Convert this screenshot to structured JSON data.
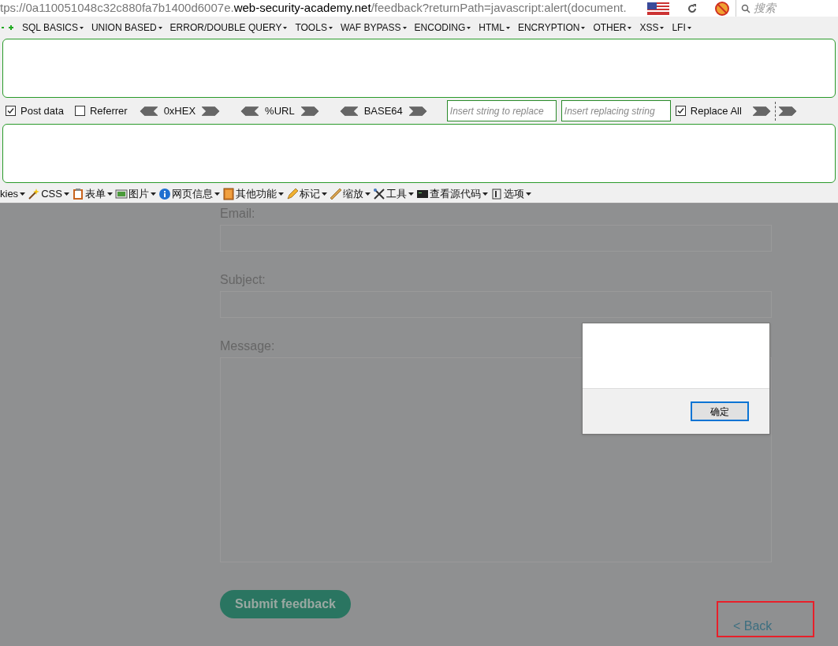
{
  "address_bar": {
    "url_prefix": "tps://0a110051048c32c880fa7b1400d6007e.",
    "url_host": "web-security-academy.net",
    "url_path": "/feedback?returnPath=javascript:alert(document."
  },
  "search": {
    "placeholder": "搜索"
  },
  "hackbar": {
    "menus": [
      "SQL BASICS",
      "UNION BASED",
      "ERROR/DOUBLE QUERY",
      "TOOLS",
      "WAF BYPASS",
      "ENCODING",
      "HTML",
      "ENCRYPTION",
      "OTHER",
      "XSS",
      "LFI"
    ],
    "options": [
      {
        "kind": "checkbox",
        "label": "Post data",
        "checked": true
      },
      {
        "kind": "checkbox",
        "label": "Referrer",
        "checked": false
      },
      {
        "kind": "encoder",
        "label": "0xHEX"
      },
      {
        "kind": "encoder",
        "label": "%URL"
      },
      {
        "kind": "encoder",
        "label": "BASE64"
      },
      {
        "kind": "field",
        "placeholder": "Insert string to replace"
      },
      {
        "kind": "field",
        "placeholder": "Insert replacing string"
      },
      {
        "kind": "checkbox",
        "label": "Replace All",
        "checked": true
      }
    ]
  },
  "toolbar": [
    "kies",
    "CSS",
    "表单",
    "图片",
    "网页信息",
    "其他功能",
    "标记",
    "缩放",
    "工具",
    "查看源代码",
    "选项"
  ],
  "form": {
    "fields": [
      {
        "label": "Email:",
        "kind": "input"
      },
      {
        "label": "Subject:",
        "kind": "input"
      },
      {
        "label": "Message:",
        "kind": "textarea"
      }
    ],
    "submit": "Submit feedback",
    "back": "< Back"
  },
  "dialog": {
    "button": "确定"
  }
}
